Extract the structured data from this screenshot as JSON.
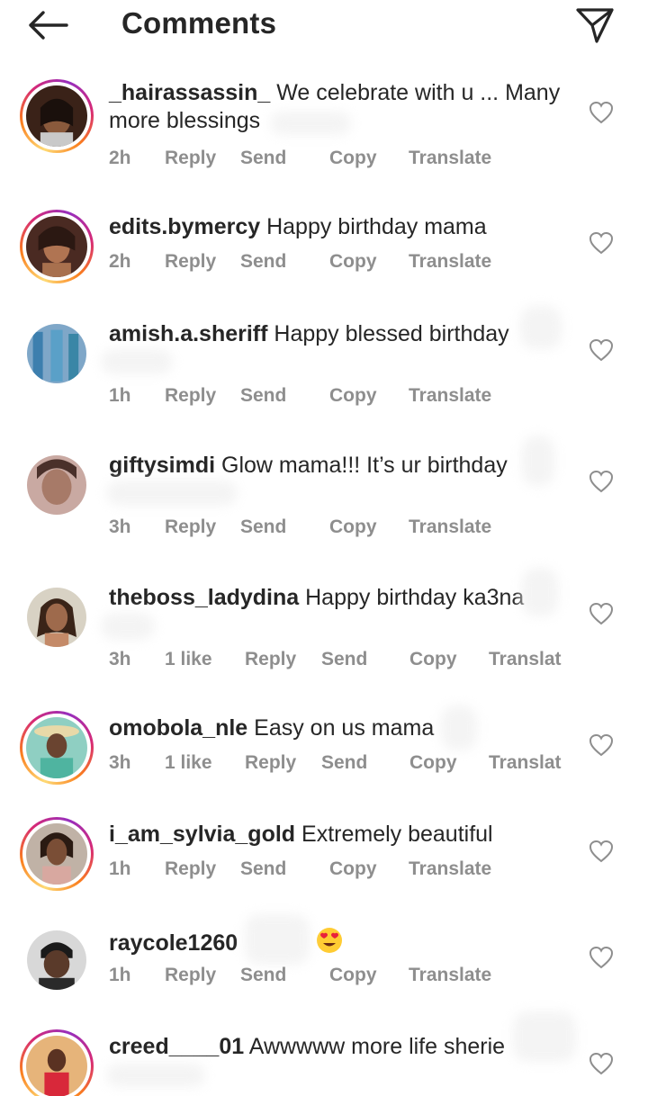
{
  "header": {
    "title": "Comments",
    "back_icon": "arrow-left-icon",
    "send_icon": "paper-plane-icon"
  },
  "colors": {
    "text": "#262626",
    "meta": "#8e8e8e",
    "ring": [
      "#feda75",
      "#fa7e1e",
      "#d62976",
      "#962fbf"
    ]
  },
  "actions": {
    "reply": "Reply",
    "send": "Send",
    "copy": "Copy",
    "translate": "Translate",
    "translate_truncated": "Translat"
  },
  "comments": [
    {
      "username": "_hairassassin_",
      "text": "We celebrate with u ... Many more blessings",
      "time": "2h",
      "likes": "",
      "ring": true
    },
    {
      "username": "edits.bymercy",
      "text": "Happy birthday mama",
      "time": "2h",
      "likes": "",
      "ring": true
    },
    {
      "username": "amish.a.sheriff",
      "text": "Happy blessed birthday",
      "time": "1h",
      "likes": "",
      "ring": false
    },
    {
      "username": "giftysimdi",
      "text": "Glow mama!!! It’s ur birthday",
      "time": "3h",
      "likes": "",
      "ring": false
    },
    {
      "username": "theboss_ladydina",
      "text": "Happy birthday ka3na",
      "time": "3h",
      "likes": "1 like",
      "ring": false
    },
    {
      "username": "omobola_nle",
      "text": "Easy on us mama",
      "time": "3h",
      "likes": "1 like",
      "ring": true
    },
    {
      "username": "i_am_sylvia_gold",
      "text": "Extremely beautiful",
      "time": "1h",
      "likes": "",
      "ring": true
    },
    {
      "username": "raycole1260",
      "text": "",
      "emoji": "heart-eyes-emoji",
      "time": "1h",
      "likes": "",
      "ring": false
    },
    {
      "username": "creed____01",
      "text": "Awwwww more life sherie",
      "time": "",
      "likes": "",
      "ring": true
    }
  ]
}
